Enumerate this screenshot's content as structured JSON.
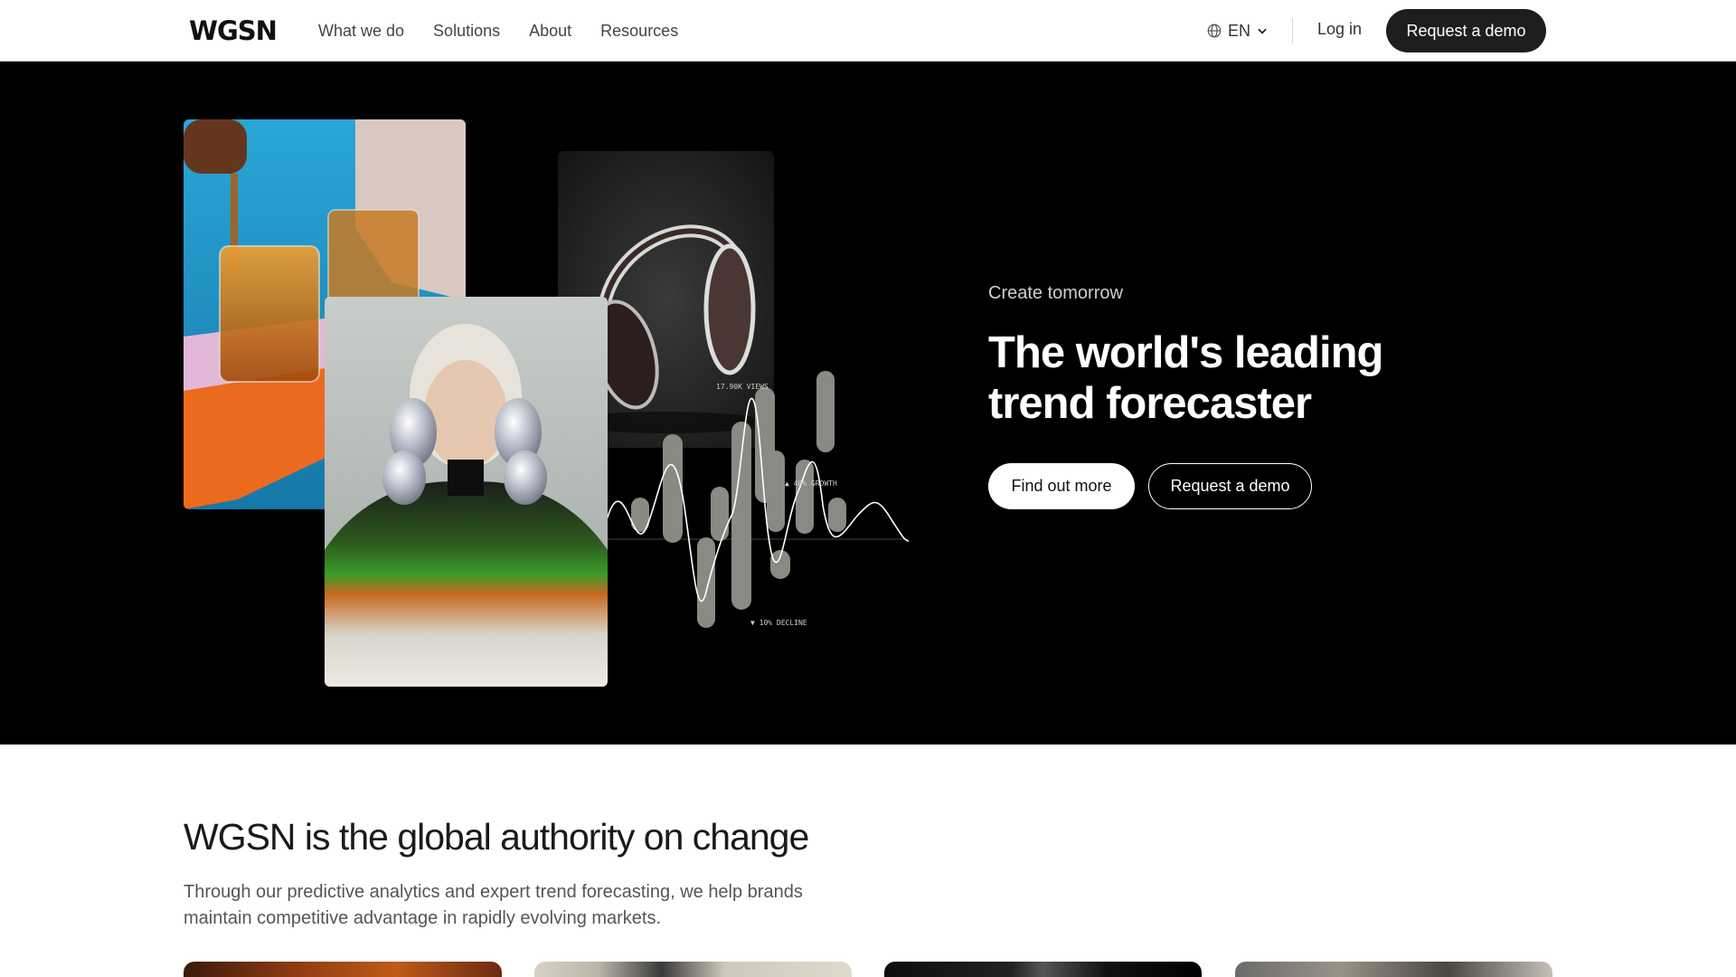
{
  "nav": {
    "logo": "WGSN",
    "links": [
      "What we do",
      "Solutions",
      "About",
      "Resources"
    ],
    "language": "EN",
    "login": "Log in",
    "request_demo": "Request a demo"
  },
  "hero": {
    "eyebrow": "Create tomorrow",
    "headline": "The world's leading trend forecaster",
    "primary_button": "Find out more",
    "secondary_button": "Request a demo",
    "chart_labels": {
      "views": "17.90K VIEWS",
      "growth": "▲ 40% GROWTH",
      "decline": "▼ 10% DECLINE"
    }
  },
  "authority": {
    "title": "WGSN is the global authority on change",
    "body": "Through our predictive analytics and expert trend forecasting, we help brands maintain competitive advantage in rapidly evolving markets."
  },
  "colors": {
    "hero_bg": "#000000",
    "primary_dark": "#1e1e1e",
    "white": "#ffffff"
  },
  "icons": [
    "globe-icon",
    "chevron-down-icon"
  ]
}
